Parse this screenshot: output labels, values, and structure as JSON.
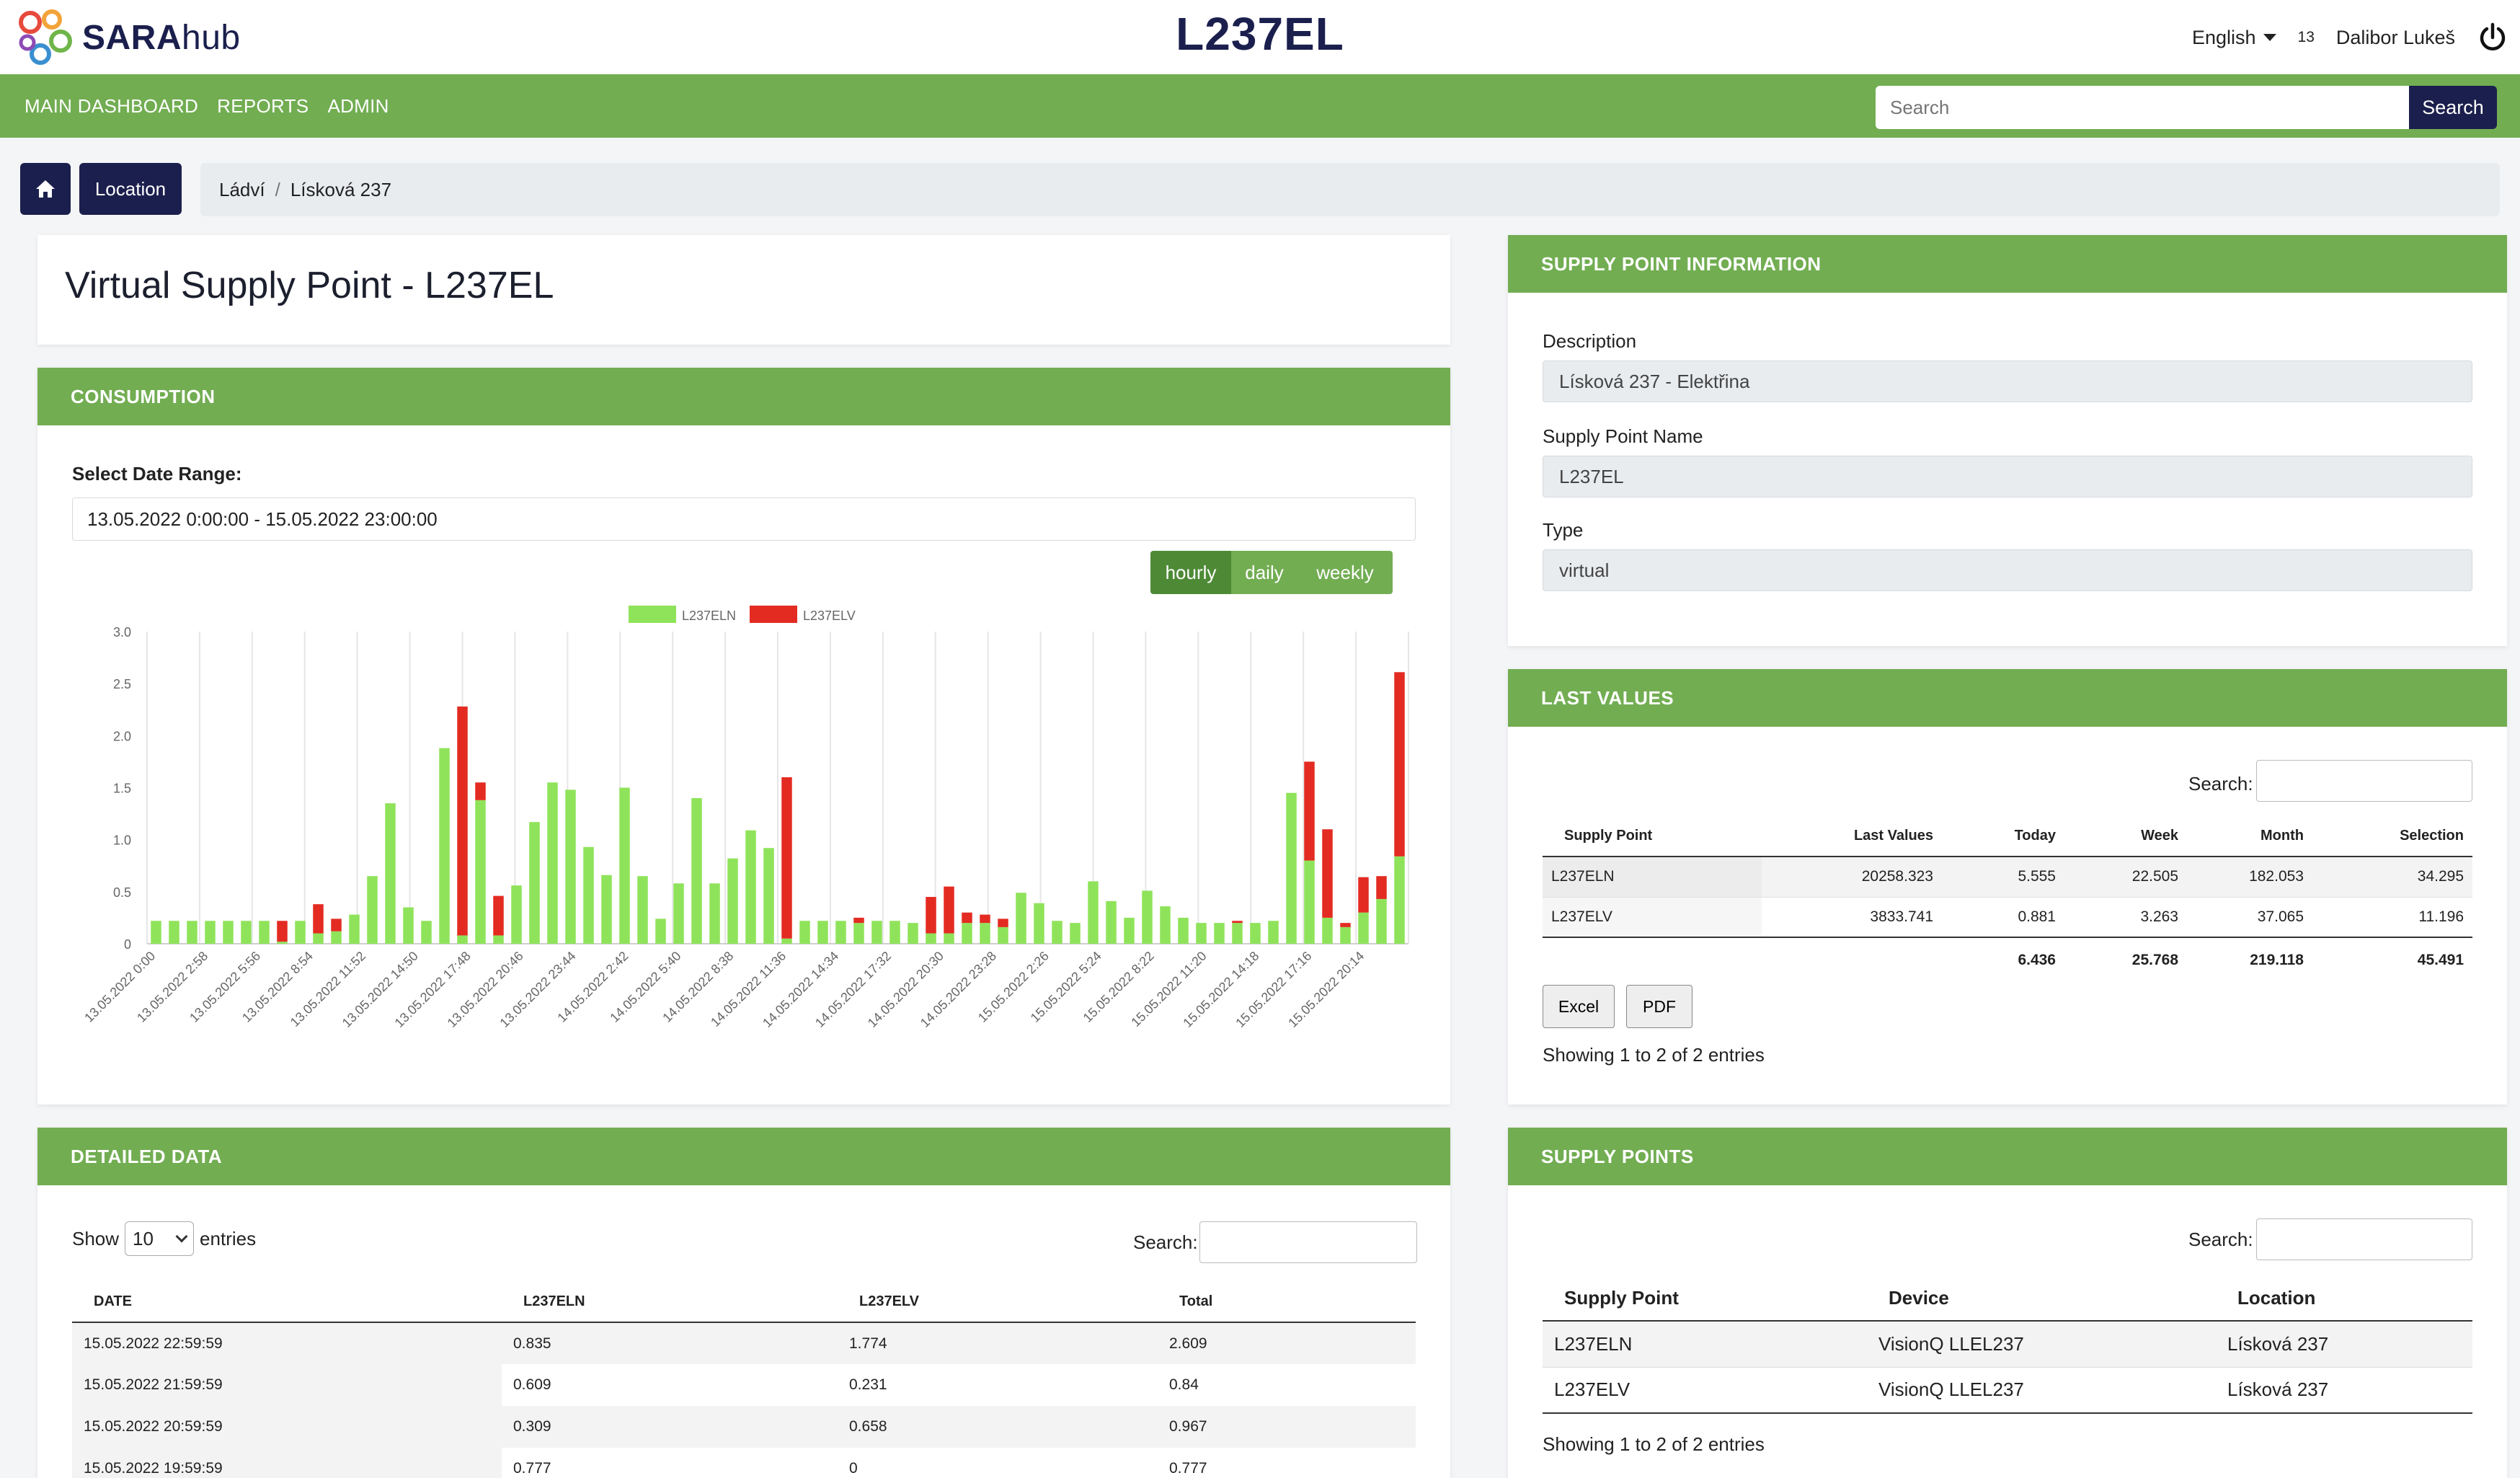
{
  "brand": {
    "name_bold": "SARA",
    "name_light": "hub"
  },
  "site_title": "L237EL",
  "top_right": {
    "language": "English",
    "notification_count": "13",
    "user": "Dalibor Lukeš"
  },
  "nav": {
    "links": [
      "MAIN DASHBOARD",
      "REPORTS",
      "ADMIN"
    ],
    "search_placeholder": "Search",
    "search_button": "Search"
  },
  "breadcrumb": {
    "location_button": "Location",
    "items": [
      "Ládví",
      "Lísková 237"
    ]
  },
  "vsp_title": "Virtual Supply Point - L237EL",
  "consumption": {
    "header": "CONSUMPTION",
    "date_range_label": "Select Date Range:",
    "date_range_value": "13.05.2022 0:00:00 - 15.05.2022 23:00:00",
    "range_buttons": [
      "hourly",
      "daily",
      "weekly"
    ],
    "active_range": "hourly"
  },
  "chart_data": {
    "type": "bar",
    "stacked": true,
    "legend_position": "top",
    "colors": {
      "L237ELN": "#8fe35a",
      "L237ELV": "#e32b22"
    },
    "ylim": [
      0,
      3.0
    ],
    "yticks": [
      "0",
      "0.5",
      "1.0",
      "1.5",
      "2.0",
      "2.5",
      "3.0"
    ],
    "grid_x": true,
    "tick_labels": [
      "13.05.2022 0:00",
      "13.05.2022 2:58",
      "13.05.2022 5:56",
      "13.05.2022 8:54",
      "13.05.2022 11:52",
      "13.05.2022 14:50",
      "13.05.2022 17:48",
      "13.05.2022 20:46",
      "13.05.2022 23:44",
      "14.05.2022 2:42",
      "14.05.2022 5:40",
      "14.05.2022 8:38",
      "14.05.2022 11:36",
      "14.05.2022 14:34",
      "14.05.2022 17:32",
      "14.05.2022 20:30",
      "14.05.2022 23:28",
      "15.05.2022 2:26",
      "15.05.2022 5:24",
      "15.05.2022 8:22",
      "15.05.2022 11:20",
      "15.05.2022 14:18",
      "15.05.2022 17:16",
      "15.05.2022 20:14"
    ],
    "series": [
      {
        "name": "L237ELN",
        "values": [
          0.22,
          0.22,
          0.22,
          0.22,
          0.22,
          0.22,
          0.22,
          0.02,
          0.22,
          0.1,
          0.12,
          0.28,
          0.65,
          1.35,
          0.35,
          0.22,
          1.88,
          0.08,
          1.38,
          0.08,
          0.56,
          1.17,
          1.55,
          1.48,
          0.93,
          0.66,
          1.5,
          0.65,
          0.24,
          0.58,
          1.4,
          0.58,
          0.82,
          1.09,
          0.92,
          0.05,
          0.22,
          0.22,
          0.22,
          0.2,
          0.22,
          0.22,
          0.2,
          0.1,
          0.1,
          0.2,
          0.2,
          0.16,
          0.49,
          0.39,
          0.22,
          0.2,
          0.6,
          0.41,
          0.25,
          0.51,
          0.36,
          0.25,
          0.2,
          0.2,
          0.2,
          0.2,
          0.22,
          1.45,
          0.8,
          0.25,
          0.16,
          0.3,
          0.43,
          0.84
        ]
      },
      {
        "name": "L237ELV",
        "values": [
          0,
          0,
          0,
          0,
          0,
          0,
          0,
          0.2,
          0,
          0.28,
          0.12,
          0,
          0,
          0,
          0,
          0,
          0,
          2.2,
          0.17,
          0.38,
          0,
          0,
          0,
          0,
          0,
          0,
          0,
          0,
          0,
          0,
          0,
          0,
          0,
          0,
          0,
          1.55,
          0,
          0,
          0,
          0.05,
          0,
          0,
          0,
          0.35,
          0.45,
          0.1,
          0.08,
          0.08,
          0,
          0,
          0,
          0,
          0,
          0,
          0,
          0,
          0,
          0,
          0,
          0,
          0.02,
          0,
          0,
          0,
          0.95,
          0.85,
          0.04,
          0.34,
          0.22,
          1.77
        ]
      }
    ]
  },
  "detailed": {
    "header": "DETAILED DATA",
    "show_label": "Show",
    "entries_value": "10",
    "entries_label": "entries",
    "search_label": "Search:",
    "columns": [
      "DATE",
      "L237ELN",
      "L237ELV",
      "Total"
    ],
    "rows": [
      [
        "15.05.2022 22:59:59",
        "0.835",
        "1.774",
        "2.609"
      ],
      [
        "15.05.2022 21:59:59",
        "0.609",
        "0.231",
        "0.84"
      ],
      [
        "15.05.2022 20:59:59",
        "0.309",
        "0.658",
        "0.967"
      ],
      [
        "15.05.2022 19:59:59",
        "0.777",
        "0",
        "0.777"
      ]
    ]
  },
  "info": {
    "header": "SUPPLY POINT INFORMATION",
    "description_label": "Description",
    "description_value": "Lísková 237 - Elektřina",
    "name_label": "Supply Point Name",
    "name_value": "L237EL",
    "type_label": "Type",
    "type_value": "virtual"
  },
  "last_values": {
    "header": "LAST VALUES",
    "search_label": "Search:",
    "columns": [
      "Supply Point",
      "Last Values",
      "Today",
      "Week",
      "Month",
      "Selection"
    ],
    "rows": [
      [
        "L237ELN",
        "20258.323",
        "5.555",
        "22.505",
        "182.053",
        "34.295"
      ],
      [
        "L237ELV",
        "3833.741",
        "0.881",
        "3.263",
        "37.065",
        "11.196"
      ]
    ],
    "totals": [
      "",
      "",
      "6.436",
      "25.768",
      "219.118",
      "45.491"
    ],
    "excel_button": "Excel",
    "pdf_button": "PDF",
    "showing": "Showing 1 to 2 of 2 entries"
  },
  "supply_points": {
    "header": "SUPPLY POINTS",
    "search_label": "Search:",
    "columns": [
      "Supply Point",
      "Device",
      "Location"
    ],
    "rows": [
      [
        "L237ELN",
        "VisionQ LLEL237",
        "Lísková 237"
      ],
      [
        "L237ELV",
        "VisionQ LLEL237",
        "Lísková 237"
      ]
    ],
    "showing": "Showing 1 to 2 of 2 entries"
  }
}
